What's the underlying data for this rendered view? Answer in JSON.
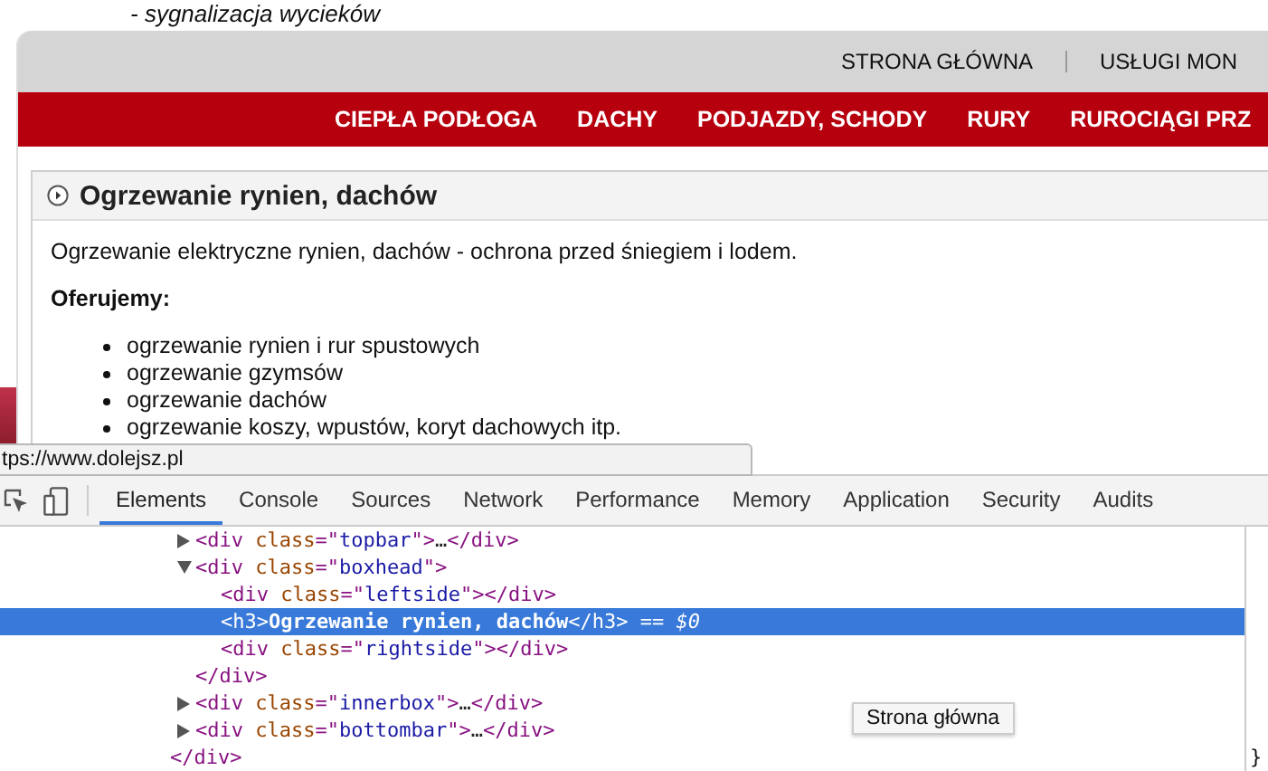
{
  "page_intro": "- sygnalizacja wycieków",
  "top_links": [
    {
      "label": "STRONA GŁÓWNA"
    },
    {
      "label": "USŁUGI MON"
    }
  ],
  "nav": [
    "CIEPŁA PODŁOGA",
    "DACHY",
    "PODJAZDY, SCHODY",
    "RURY",
    "RUROCIĄGI PRZ"
  ],
  "box": {
    "title": "Ogrzewanie rynien, dachów",
    "intro": "Ogrzewanie elektryczne rynien, dachów - ochrona przed śniegiem i lodem.",
    "offer_heading": "Oferujemy:",
    "items": [
      "ogrzewanie rynien i rur spustowych",
      "ogrzewanie gzymsów",
      "ogrzewanie dachów",
      "ogrzewanie koszy, wpustów, koryt dachowych itp."
    ]
  },
  "status_url": "tps://www.dolejsz.pl",
  "devtools": {
    "tabs": [
      {
        "label": "Elements",
        "selected": true
      },
      {
        "label": "Console",
        "selected": false
      },
      {
        "label": "Sources",
        "selected": false
      },
      {
        "label": "Network",
        "selected": false
      },
      {
        "label": "Performance",
        "selected": false
      },
      {
        "label": "Memory",
        "selected": false
      },
      {
        "label": "Application",
        "selected": false
      },
      {
        "label": "Security",
        "selected": false
      },
      {
        "label": "Audits",
        "selected": false
      }
    ],
    "dom": {
      "children": [
        {
          "expanded": false,
          "selected": false,
          "tokens": [
            {
              "kind": "tag",
              "text": "<div "
            },
            {
              "kind": "attr",
              "text": "class"
            },
            {
              "kind": "tag",
              "text": "=\""
            },
            {
              "kind": "val",
              "text": "topbar"
            },
            {
              "kind": "tag",
              "text": "\">"
            },
            {
              "kind": "text",
              "text": "…"
            },
            {
              "kind": "tag",
              "text": "</div>"
            }
          ]
        },
        {
          "expanded": true,
          "selected": false,
          "tokens": [
            {
              "kind": "tag",
              "text": "<div "
            },
            {
              "kind": "attr",
              "text": "class"
            },
            {
              "kind": "tag",
              "text": "=\""
            },
            {
              "kind": "val",
              "text": "boxhead"
            },
            {
              "kind": "tag",
              "text": "\">"
            }
          ],
          "children": [
            {
              "selected": false,
              "tokens": [
                {
                  "kind": "tag",
                  "text": "<div "
                },
                {
                  "kind": "attr",
                  "text": "class"
                },
                {
                  "kind": "tag",
                  "text": "=\""
                },
                {
                  "kind": "val",
                  "text": "leftside"
                },
                {
                  "kind": "tag",
                  "text": "\"></div>"
                }
              ]
            },
            {
              "selected": true,
              "tokens": [
                {
                  "kind": "tag",
                  "text": "<h3>"
                },
                {
                  "kind": "text",
                  "text": "Ogrzewanie rynien, dachów"
                },
                {
                  "kind": "tag",
                  "text": "</h3>"
                },
                {
                  "kind": "note",
                  "text": " == $0"
                }
              ]
            },
            {
              "selected": false,
              "tokens": [
                {
                  "kind": "tag",
                  "text": "<div "
                },
                {
                  "kind": "attr",
                  "text": "class"
                },
                {
                  "kind": "tag",
                  "text": "=\""
                },
                {
                  "kind": "val",
                  "text": "rightside"
                },
                {
                  "kind": "tag",
                  "text": "\"></div>"
                }
              ]
            }
          ],
          "close": [
            {
              "kind": "tag",
              "text": "</div>"
            }
          ]
        },
        {
          "expanded": false,
          "selected": false,
          "tokens": [
            {
              "kind": "tag",
              "text": "<div "
            },
            {
              "kind": "attr",
              "text": "class"
            },
            {
              "kind": "tag",
              "text": "=\""
            },
            {
              "kind": "val",
              "text": "innerbox"
            },
            {
              "kind": "tag",
              "text": "\">"
            },
            {
              "kind": "text",
              "text": "…"
            },
            {
              "kind": "tag",
              "text": "</div>"
            }
          ]
        },
        {
          "expanded": false,
          "selected": false,
          "tokens": [
            {
              "kind": "tag",
              "text": "<div "
            },
            {
              "kind": "attr",
              "text": "class"
            },
            {
              "kind": "tag",
              "text": "=\""
            },
            {
              "kind": "val",
              "text": "bottombar"
            },
            {
              "kind": "tag",
              "text": "\">"
            },
            {
              "kind": "text",
              "text": "…"
            },
            {
              "kind": "tag",
              "text": "</div>"
            }
          ]
        }
      ],
      "close": [
        {
          "kind": "tag",
          "text": "</div>"
        }
      ]
    },
    "styles_fragment": "}"
  },
  "tooltip": "Strona główna"
}
